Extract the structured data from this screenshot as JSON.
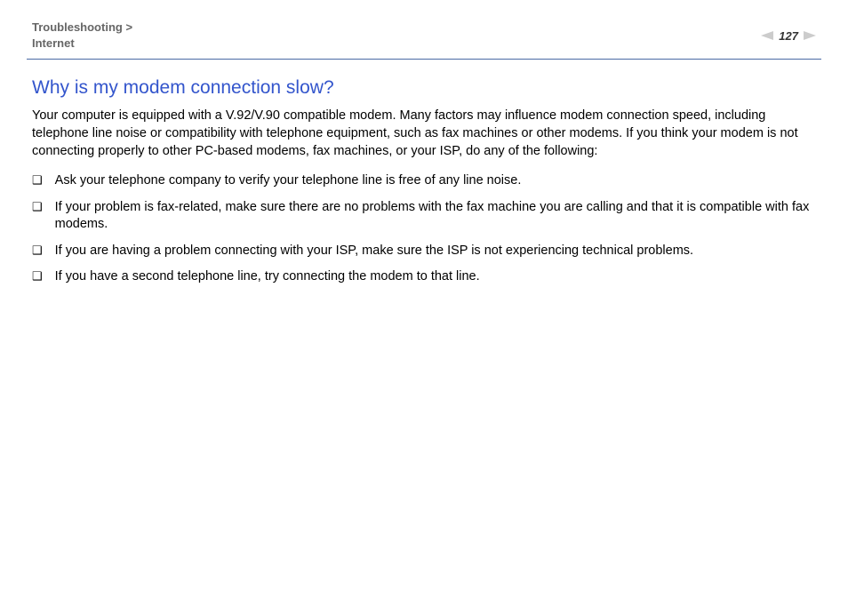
{
  "header": {
    "breadcrumb_section": "Troubleshooting",
    "breadcrumb_sep": ">",
    "breadcrumb_sub": "Internet",
    "page_number": "127"
  },
  "main": {
    "title": "Why is my modem connection slow?",
    "intro": "Your computer is equipped with a V.92/V.90 compatible modem. Many factors may influence modem connection speed, including telephone line noise or compatibility with telephone equipment, such as fax machines or other modems. If you think your modem is not connecting properly to other PC-based modems, fax machines, or your ISP, do any of the following:",
    "items": [
      "Ask your telephone company to verify your telephone line is free of any line noise.",
      "If your problem is fax-related, make sure there are no problems with the fax machine you are calling and that it is compatible with fax modems.",
      "If you are having a problem connecting with your ISP, make sure the ISP is not experiencing technical problems.",
      "If you have a second telephone line, try connecting the modem to that line."
    ]
  }
}
